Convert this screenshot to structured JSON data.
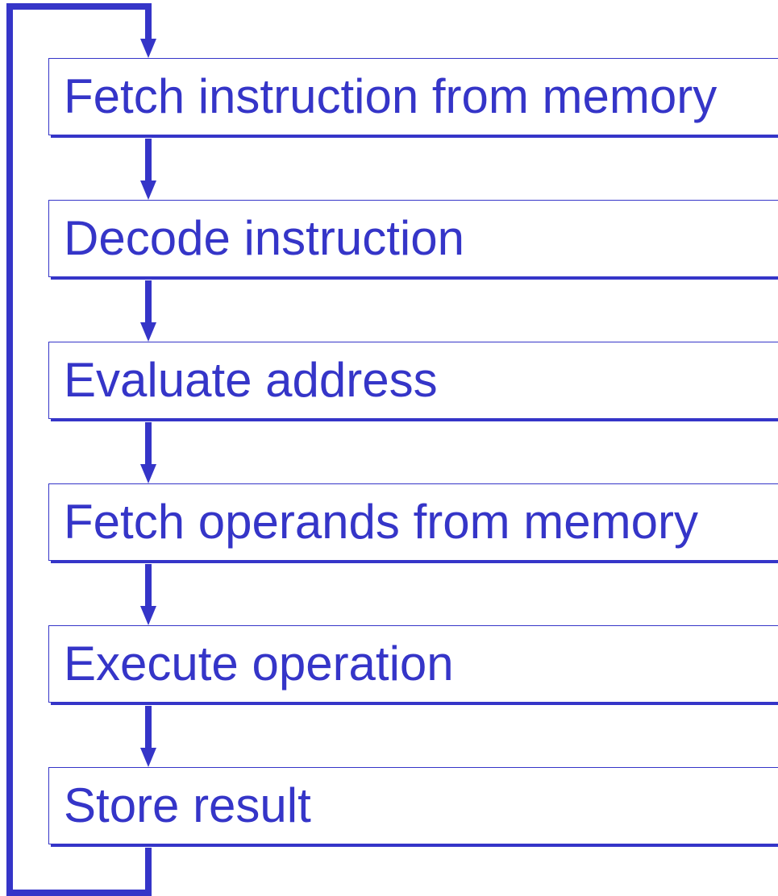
{
  "colors": {
    "accent": "#3535c8",
    "background": "#ffffff"
  },
  "steps": [
    {
      "label": "Fetch instruction from memory"
    },
    {
      "label": "Decode instruction"
    },
    {
      "label": "Evaluate address"
    },
    {
      "label": "Fetch operands from memory"
    },
    {
      "label": "Execute operation"
    },
    {
      "label": "Store result"
    }
  ]
}
